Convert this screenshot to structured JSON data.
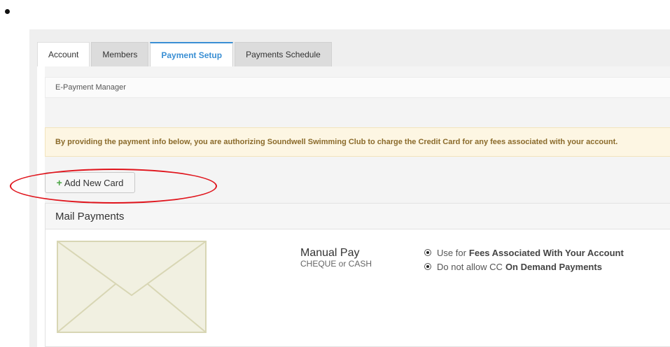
{
  "tabs": [
    {
      "label": "Account"
    },
    {
      "label": "Members"
    },
    {
      "label": "Payment Setup"
    },
    {
      "label": "Payments Schedule"
    }
  ],
  "active_tab": "Payment Setup",
  "breadcrumb": "E-Payment Manager",
  "alert_text": "By providing the payment info below, you are authorizing Soundwell Swimming Club to charge the Credit Card for any fees associated with your account.",
  "add_card_label": "Add New Card",
  "mail_payments": {
    "title": "Mail Payments",
    "manual_title": "Manual Pay",
    "manual_sub": "CHEQUE or CASH",
    "options": [
      {
        "prefix": "Use for",
        "bold": "Fees Associated With Your Account"
      },
      {
        "prefix": "Do not allow CC",
        "bold": "On Demand Payments"
      }
    ]
  },
  "colors": {
    "accent": "#3a8fd4",
    "alert_bg": "#fdf6e3",
    "highlight": "#e0141c",
    "plus": "#4aa544"
  }
}
